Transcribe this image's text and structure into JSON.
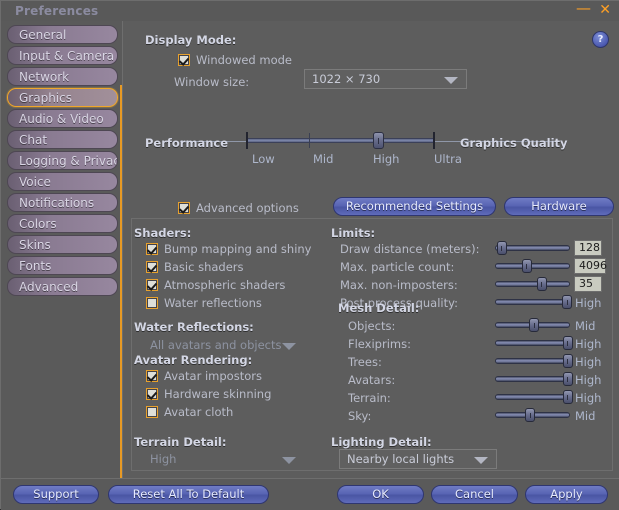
{
  "window": {
    "title": "Preferences",
    "minimize_label": "—",
    "close_label": "✕"
  },
  "sidebar": {
    "items": [
      {
        "label": "General",
        "selected": false
      },
      {
        "label": "Input & Camera",
        "selected": false
      },
      {
        "label": "Network",
        "selected": false
      },
      {
        "label": "Graphics",
        "selected": true
      },
      {
        "label": "Audio & Video",
        "selected": false
      },
      {
        "label": "Chat",
        "selected": false
      },
      {
        "label": "Logging & Privacy",
        "selected": false
      },
      {
        "label": "Voice",
        "selected": false
      },
      {
        "label": "Notifications",
        "selected": false
      },
      {
        "label": "Colors",
        "selected": false
      },
      {
        "label": "Skins",
        "selected": false
      },
      {
        "label": "Fonts",
        "selected": false
      },
      {
        "label": "Advanced",
        "selected": false
      }
    ]
  },
  "help": {
    "label": "?"
  },
  "display_mode": {
    "heading": "Display Mode:",
    "windowed_mode_label": "Windowed mode",
    "windowed_mode_checked": true,
    "window_size_label": "Window size:",
    "window_size_value": "1022 × 730"
  },
  "performance": {
    "left_label": "Performance",
    "right_label": "Graphics Quality",
    "ticks": [
      "Low",
      "Mid",
      "High",
      "Ultra"
    ],
    "value_percent": 70,
    "advanced_options_label": "Advanced options",
    "advanced_options_checked": true,
    "recommended_settings_label": "Recommended Settings",
    "hardware_label": "Hardware"
  },
  "shaders": {
    "heading": "Shaders:",
    "items": [
      {
        "label": "Bump mapping and shiny",
        "checked": true
      },
      {
        "label": "Basic shaders",
        "checked": true
      },
      {
        "label": "Atmospheric shaders",
        "checked": true
      },
      {
        "label": "Water reflections",
        "checked": false
      }
    ]
  },
  "water_reflections": {
    "heading": "Water Reflections:",
    "value": "All avatars and objects",
    "enabled": false
  },
  "avatar_rendering": {
    "heading": "Avatar Rendering:",
    "items": [
      {
        "label": "Avatar impostors",
        "checked": true
      },
      {
        "label": "Hardware skinning",
        "checked": true
      },
      {
        "label": "Avatar cloth",
        "checked": false
      }
    ]
  },
  "terrain_detail": {
    "heading": "Terrain Detail:",
    "value": "High",
    "enabled": false
  },
  "limits": {
    "heading": "Limits:",
    "rows": [
      {
        "label": "Draw distance (meters):",
        "percent": 9,
        "value": "128",
        "type": "field"
      },
      {
        "label": "Max. particle count:",
        "percent": 42,
        "value": "4096",
        "type": "field"
      },
      {
        "label": "Max. non-imposters:",
        "percent": 62,
        "value": "35",
        "type": "field"
      },
      {
        "label": "Post process quality:",
        "percent": 96,
        "value": "High",
        "type": "text"
      }
    ]
  },
  "mesh_detail": {
    "heading": "Mesh Detail:",
    "rows": [
      {
        "label": "Objects:",
        "percent": 52,
        "value": "Mid"
      },
      {
        "label": "Flexiprims:",
        "percent": 97,
        "value": "High"
      },
      {
        "label": "Trees:",
        "percent": 97,
        "value": "High"
      },
      {
        "label": "Avatars:",
        "percent": 97,
        "value": "High"
      },
      {
        "label": "Terrain:",
        "percent": 97,
        "value": "High"
      },
      {
        "label": "Sky:",
        "percent": 47,
        "value": "Mid"
      }
    ]
  },
  "lighting_detail": {
    "heading": "Lighting Detail:",
    "value": "Nearby local lights",
    "enabled": true
  },
  "footer": {
    "support_label": "Support",
    "reset_label": "Reset All To Default",
    "ok_label": "OK",
    "cancel_label": "Cancel",
    "apply_label": "Apply"
  },
  "colors": {
    "accent_orange": "#e89a24",
    "panel_bg": "#5d5d5d",
    "button_blue": "#5965b4",
    "label_text": "#b9bcc9"
  }
}
